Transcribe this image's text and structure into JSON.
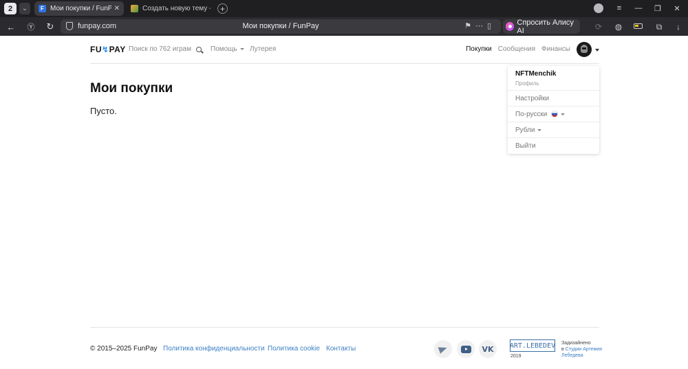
{
  "browser": {
    "tab_count": "2",
    "tabs": [
      {
        "title": "Мои покупки / FunPay",
        "favicon": "F",
        "active": true
      },
      {
        "title": "Создать новую тему - Reddit",
        "favicon": "",
        "active": false
      }
    ],
    "url_host": "funpay.com",
    "url_page_title": "Мои покупки / FunPay",
    "alice_label": "Спросить Алису AI"
  },
  "header": {
    "logo_left": "FU",
    "logo_right": "PAY",
    "search": "Поиск по 762 играм",
    "help": "Помощь",
    "lottery": "Лутерея",
    "nav": [
      "Покупки",
      "Сообщения",
      "Финансы"
    ]
  },
  "main": {
    "title": "Мои покупки",
    "empty": "Пусто."
  },
  "dropdown": {
    "username": "NFTMenchik",
    "profile": "Профиль",
    "settings": "Настройки",
    "language": "По-русски",
    "currency": "Рубли",
    "logout": "Выйти"
  },
  "footer": {
    "copyright": "© 2015–2025 FunPay",
    "links": [
      "Политика конфиденциальности",
      "Политика cookie",
      "Контакты"
    ],
    "artlebedev_logo": "ART.LEBEDEV",
    "artlebedev_year": "2019",
    "designed_line1": "Задизайнено",
    "designed_prefix": "в",
    "designed_studio": "Студии Артемия Лебедева"
  },
  "colors": {
    "accent": "#1d8bf0",
    "link": "#3b7fc4",
    "chrome_bg": "#1f1f22"
  }
}
